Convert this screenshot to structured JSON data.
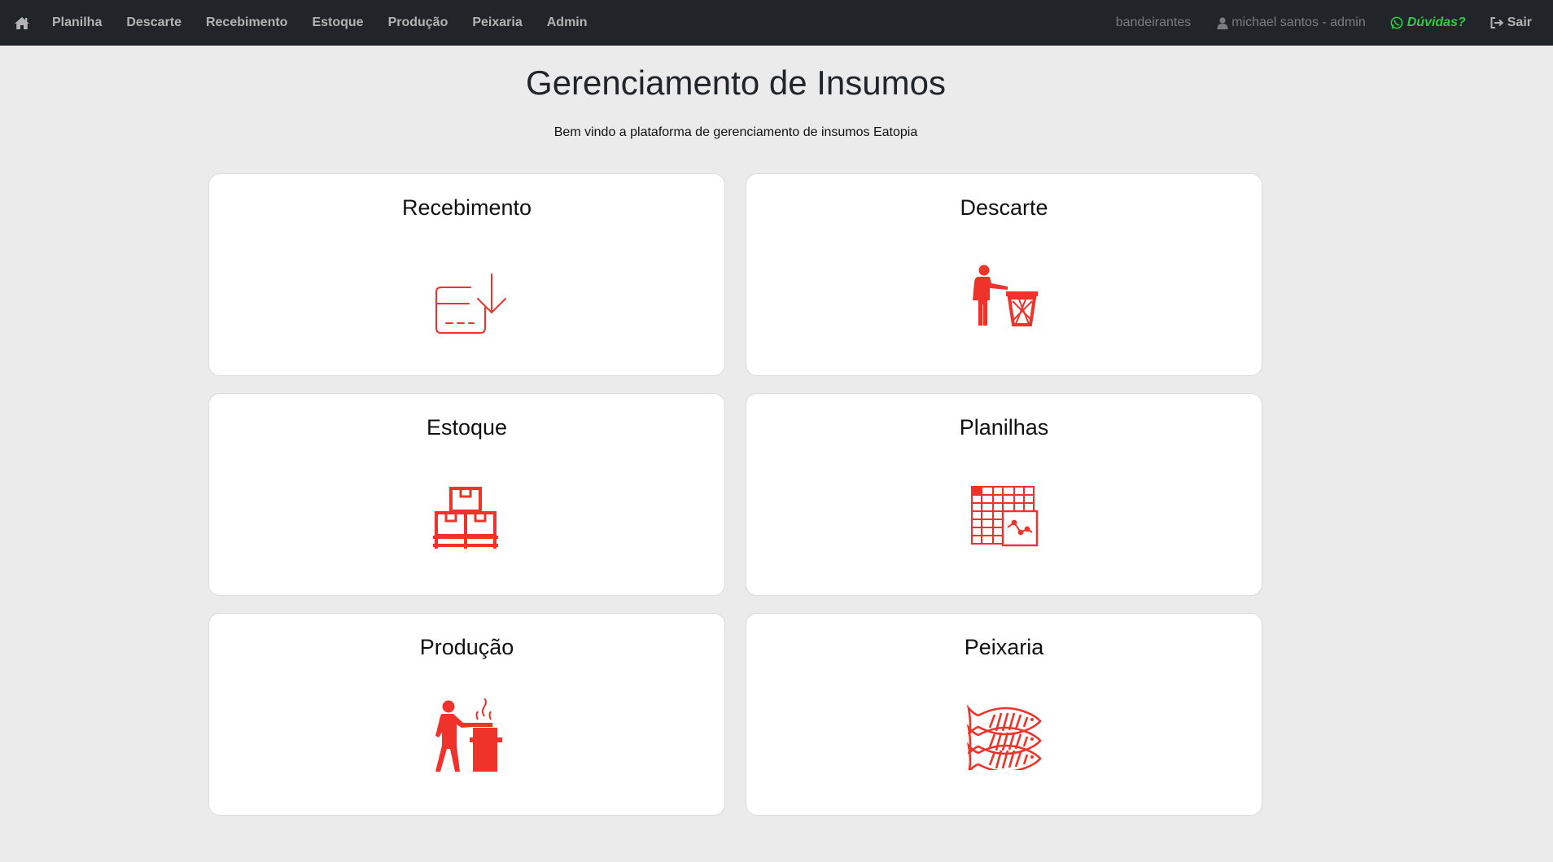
{
  "nav": {
    "home_icon": "home-icon",
    "links": [
      "Planilha",
      "Descarte",
      "Recebimento",
      "Estoque",
      "Produção",
      "Peixaria",
      "Admin"
    ],
    "store": "bandeirantes",
    "user": "michael santos - admin",
    "help": "Dúvidas?",
    "logout": "Sair"
  },
  "main": {
    "title": "Gerenciamento de Insumos",
    "subtitle": "Bem vindo a plataforma de gerenciamento de insumos Eatopia"
  },
  "cards": [
    {
      "title": "Recebimento",
      "icon": "receive-box-icon"
    },
    {
      "title": "Descarte",
      "icon": "trash-person-icon"
    },
    {
      "title": "Estoque",
      "icon": "boxes-pallet-icon"
    },
    {
      "title": "Planilhas",
      "icon": "spreadsheet-chart-icon"
    },
    {
      "title": "Produção",
      "icon": "cooking-person-icon"
    },
    {
      "title": "Peixaria",
      "icon": "fish-icon"
    }
  ],
  "colors": {
    "navbar": "#212529",
    "accent": "#f0332a",
    "help": "#2ecc40",
    "background": "#ebebeb"
  }
}
